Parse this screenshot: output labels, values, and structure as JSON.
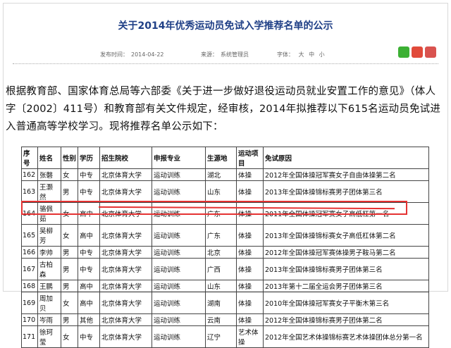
{
  "article": {
    "title": "关于2014年优秀运动员免试入学推荐名单的公示",
    "meta": {
      "published_label": "发布时间：",
      "published_date": "2014-04-22",
      "source_label": "来源：",
      "source_value": "系统管理员",
      "font_label": "字体：",
      "font_options": [
        "大",
        "中",
        "小"
      ]
    },
    "paragraph": "根据教育部、国家体育总局等六部委《关于进一步做好退役运动员就业安置工作的意见》（体人字〔2002〕411号）和教育部有关文件规定，经审核，2014年拟推荐以下615名运动员免试进入普通高等学校学习。现将推荐名单公示如下："
  },
  "table": {
    "headers": [
      "序号",
      "姓名",
      "性别",
      "学历",
      "招生院校",
      "申报专业",
      "生源地",
      "运动项目",
      "免试原因"
    ],
    "rows": [
      [
        "162",
        "张磬",
        "女",
        "中专",
        "北京体育大学",
        "运动训练",
        "湖北",
        "体操",
        "2012年全国体操冠军赛女子自由体操第二名"
      ],
      [
        "163",
        "王灏然",
        "男",
        "中专",
        "北京体育大学",
        "运动训练",
        "山东",
        "体操",
        "2013年全国体操锦标赛男子团体第三名"
      ],
      [
        "164",
        "骆佩茹",
        "女",
        "高中",
        "北京体育大学",
        "运动训练",
        "广东",
        "体操",
        "2011年全国体操冠军赛女子高低杠第一名"
      ],
      [
        "165",
        "吴柳芳",
        "女",
        "高中",
        "北京体育大学",
        "运动训练",
        "广东",
        "体操",
        "2013年全国体操锦标赛女子高低杠体第二名"
      ],
      [
        "166",
        "李帅",
        "男",
        "中专",
        "北京体育大学",
        "运动训练",
        "北京",
        "体操",
        "2012年全国体操冠军赛体操男子鞍马第二名"
      ],
      [
        "167",
        "古柏森",
        "男",
        "中专",
        "北京体育大学",
        "运动训练",
        "广西",
        "体操",
        "2013年全国体操锦标赛男子团体第三名"
      ],
      [
        "168",
        "王鹏",
        "男",
        "高中",
        "北京体育大学",
        "运动训练",
        "山东",
        "体操",
        "2013年第十二届全运会男子团体第三名"
      ],
      [
        "169",
        "周加贝",
        "女",
        "高中",
        "北京体育大学",
        "运动训练",
        "湖南",
        "体操",
        "2010年全国体操冠军赛女子平衡木第三名"
      ],
      [
        "170",
        "岑雨",
        "男",
        "其他",
        "北京体育大学",
        "运动训练",
        "云南",
        "体操",
        "2012年全国体操锦标赛男子团体第二名"
      ],
      [
        "171",
        "徐珂莹",
        "女",
        "中专",
        "北京体育大学",
        "运动训练",
        "辽宁",
        "艺术体操",
        "2012年全国艺术体操锦标赛艺术体操团体总分第一名"
      ]
    ]
  },
  "colors": {
    "title": "#1f3f86",
    "highlight": "#e53232",
    "wechat": "#3cb034",
    "weibo": "#e14a3a"
  }
}
